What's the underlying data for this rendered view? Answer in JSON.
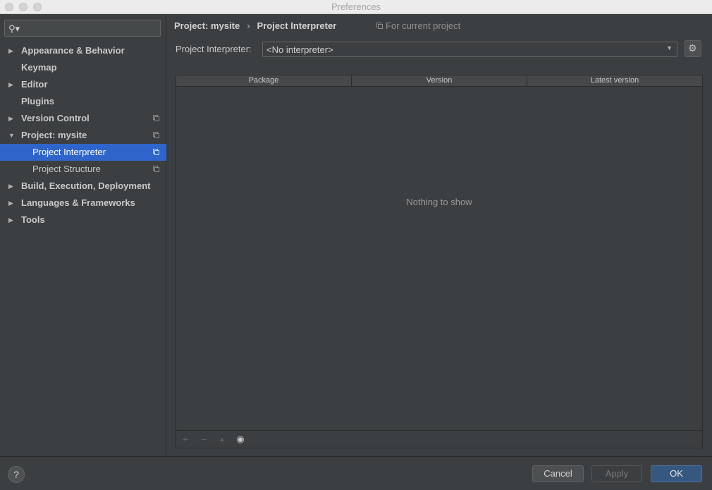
{
  "window": {
    "title": "Preferences"
  },
  "search": {
    "placeholder": ""
  },
  "sidebar": {
    "items": [
      {
        "label": "Appearance & Behavior",
        "arrow": "▶",
        "copy": false
      },
      {
        "label": "Keymap",
        "arrow": "",
        "copy": false
      },
      {
        "label": "Editor",
        "arrow": "▶",
        "copy": false
      },
      {
        "label": "Plugins",
        "arrow": "",
        "copy": false
      },
      {
        "label": "Version Control",
        "arrow": "▶",
        "copy": true
      },
      {
        "label": "Project: mysite",
        "arrow": "▼",
        "copy": true
      },
      {
        "label": "Project Interpreter",
        "arrow": "",
        "copy": true,
        "selected": true
      },
      {
        "label": "Project Structure",
        "arrow": "",
        "copy": true
      },
      {
        "label": "Build, Execution, Deployment",
        "arrow": "▶",
        "copy": false
      },
      {
        "label": "Languages & Frameworks",
        "arrow": "▶",
        "copy": false
      },
      {
        "label": "Tools",
        "arrow": "▶",
        "copy": false
      }
    ]
  },
  "breadcrumb": {
    "parent": "Project: mysite",
    "separator": "›",
    "current": "Project Interpreter",
    "scope": "For current project"
  },
  "interpreter": {
    "label": "Project Interpreter:",
    "value": "<No interpreter>"
  },
  "table": {
    "columns": [
      "Package",
      "Version",
      "Latest version"
    ],
    "empty_text": "Nothing to show",
    "toolbar": {
      "add": "+",
      "remove": "−",
      "upgrade": "▲",
      "show": "👁"
    }
  },
  "buttons": {
    "help": "?",
    "cancel": "Cancel",
    "apply": "Apply",
    "ok": "OK"
  },
  "colors": {
    "selection": "#2f65ca",
    "ok_button": "#365880",
    "background": "#3c3f41"
  }
}
